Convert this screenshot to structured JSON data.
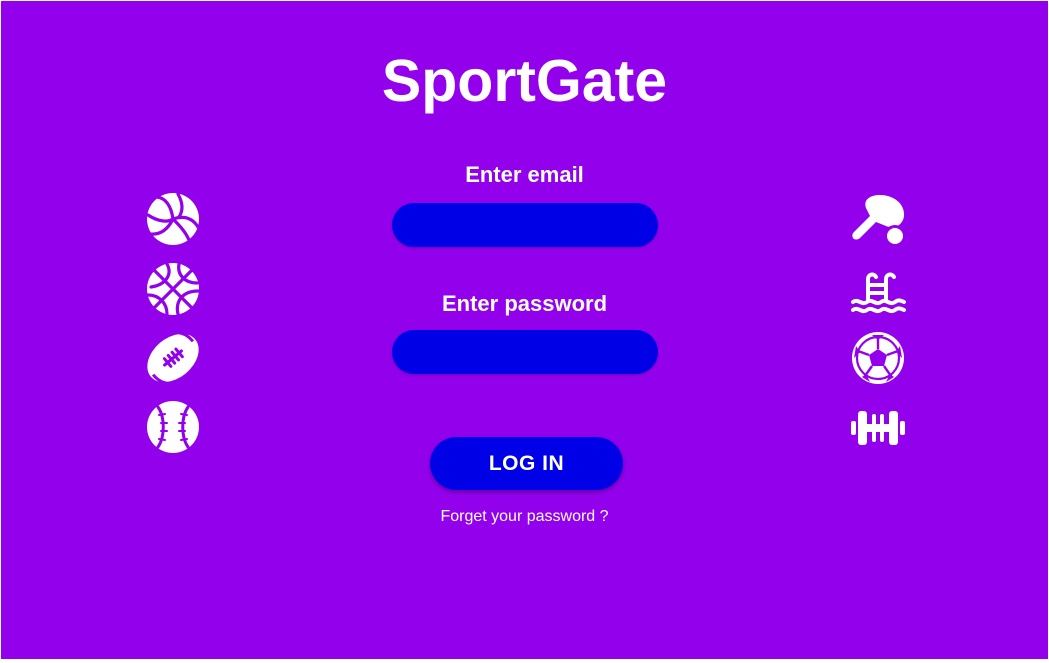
{
  "app": {
    "title": "SportGate"
  },
  "form": {
    "email_label": "Enter email",
    "email_value": "",
    "password_label": "Enter password",
    "password_value": "",
    "login_label": "LOG IN",
    "forgot_label": "Forget your password ?"
  },
  "icons": {
    "left": [
      "volleyball-icon",
      "basketball-icon",
      "football-icon",
      "baseball-icon"
    ],
    "right": [
      "ping-pong-icon",
      "swimming-pool-icon",
      "soccer-ball-icon",
      "dumbbell-icon"
    ]
  },
  "colors": {
    "background": "#9300ec",
    "field": "#0000e6",
    "text": "#ffffff"
  }
}
